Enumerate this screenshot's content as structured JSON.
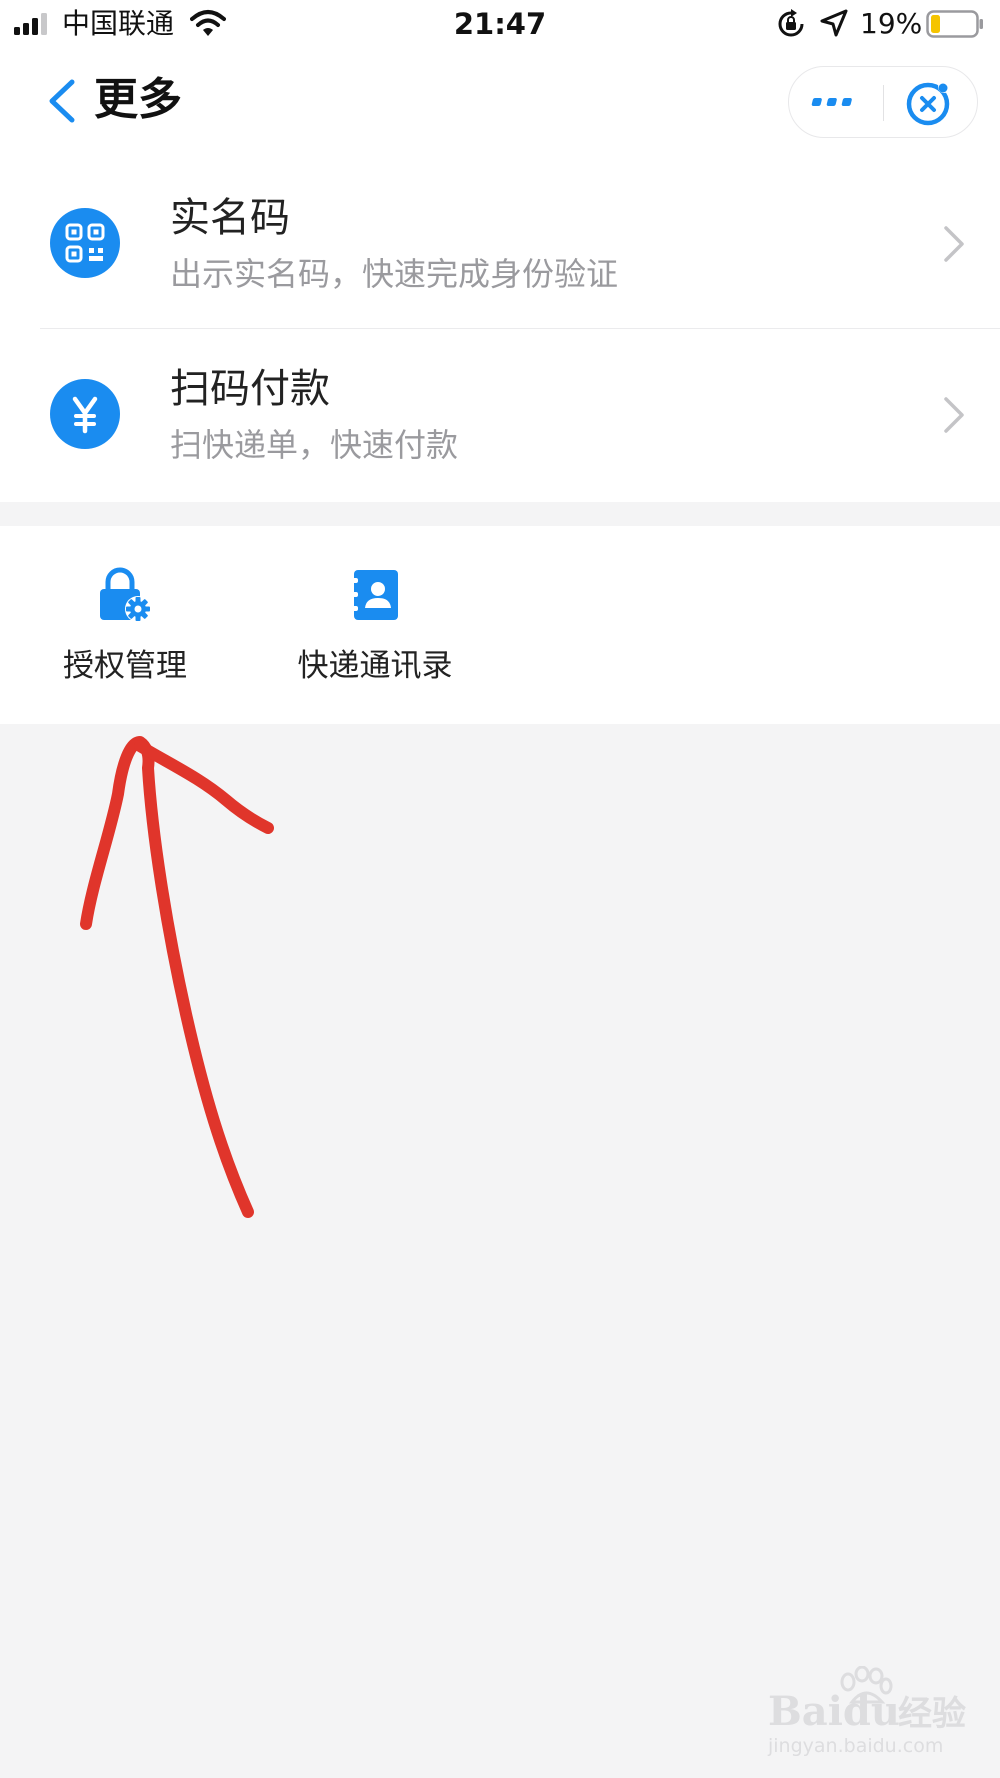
{
  "status_bar": {
    "carrier": "中国联通",
    "time": "21:47",
    "battery_percent": "19%",
    "battery_level": 0.19,
    "icons": [
      "signal-icon",
      "wifi-icon",
      "rotation-lock-icon",
      "location-icon",
      "battery-icon"
    ]
  },
  "nav": {
    "title": "更多",
    "back_icon": "chevron-left-icon",
    "capsule_icons": [
      "more-dots-icon",
      "close-circle-icon"
    ]
  },
  "list": {
    "items": [
      {
        "title": "实名码",
        "subtitle": "出示实名码，快速完成身份验证",
        "icon": "qr-code-icon"
      },
      {
        "title": "扫码付款",
        "subtitle": "扫快递单，快速付款",
        "icon": "yuan-icon"
      }
    ]
  },
  "grid": {
    "items": [
      {
        "label": "授权管理",
        "icon": "lock-gear-icon"
      },
      {
        "label": "快递通讯录",
        "icon": "contacts-book-icon"
      }
    ]
  },
  "watermark": {
    "brand": "Baidu",
    "suffix": "经验",
    "url": "jingyan.baidu.com"
  },
  "colors": {
    "accent": "#1a8cf0",
    "annotation": "#e0352b",
    "background": "#f4f4f5"
  }
}
